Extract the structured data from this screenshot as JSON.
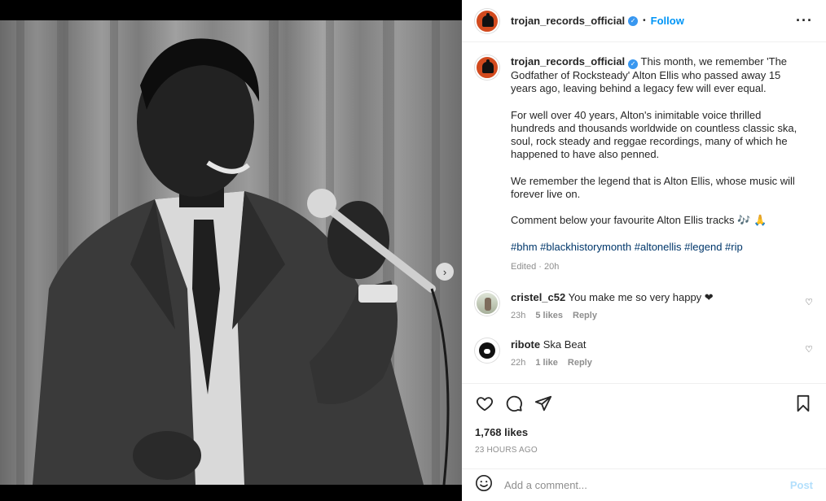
{
  "post": {
    "author": "trojan_records_official",
    "follow_label": "Follow",
    "separator": "•",
    "more_icon": "more-horizontal-icon",
    "caption": {
      "author": "trojan_records_official",
      "p1": "This month, we remember 'The Godfather of Rocksteady' Alton Ellis who passed away 15 years ago, leaving behind a legacy few will ever equal.",
      "p2": "For well over 40 years, Alton's inimitable voice thrilled hundreds and thousands worldwide on countless classic ska, soul, rock steady and reggae recordings, many of which he happened to have also penned.",
      "p3": "We remember the legend that is Alton Ellis, whose music will forever live on.",
      "p4": "Comment below your favourite Alton Ellis tracks 🎶 🙏",
      "hashtags": "#bhm #blackhistorymonth #altonellis #legend #rip",
      "edited": "Edited",
      "time_sep": " · ",
      "time": "20h"
    },
    "comments": [
      {
        "user": "cristel_c52",
        "text": "You make me so very happy ❤",
        "time": "23h",
        "likes": "5 likes",
        "reply": "Reply"
      },
      {
        "user": "ribote",
        "text": "Ska Beat",
        "time": "22h",
        "likes": "1 like",
        "reply": "Reply"
      }
    ],
    "likes": "1,768 likes",
    "posted_ago": "23 HOURS AGO",
    "add_comment_placeholder": "Add a comment...",
    "post_label": "Post",
    "carousel": {
      "next_icon": "›",
      "slide": 1,
      "slides": 2
    }
  },
  "colors": {
    "accent": "#0095f6",
    "hashtag": "#00376b",
    "muted": "#8e8e8e",
    "avatar_brand": "#d24a1e"
  }
}
